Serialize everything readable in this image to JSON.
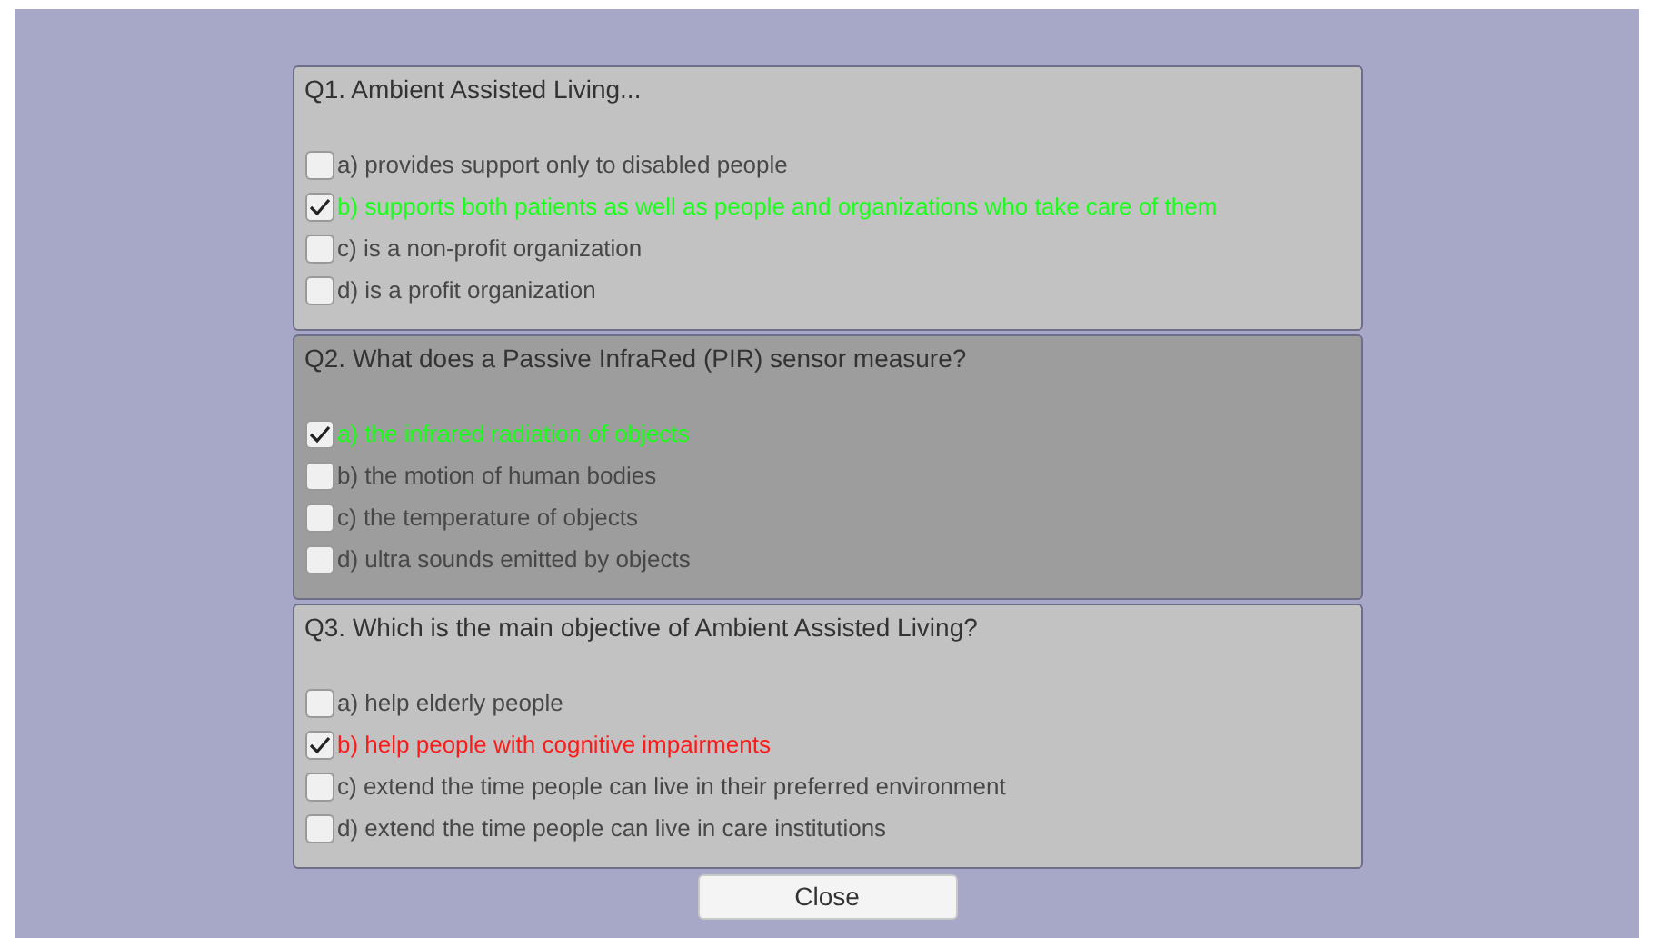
{
  "questions": [
    {
      "title": "Q1. Ambient Assisted Living...",
      "highlighted": false,
      "answers": [
        {
          "label": "a) provides support only to disabled people",
          "checked": false,
          "color": "#474747"
        },
        {
          "label": "b) supports both patients as well as people and organizations who take care of them",
          "checked": true,
          "color": "#1aff1a"
        },
        {
          "label": "c) is a non-profit organization",
          "checked": false,
          "color": "#474747"
        },
        {
          "label": "d) is a profit organization",
          "checked": false,
          "color": "#474747"
        }
      ]
    },
    {
      "title": "Q2. What does a Passive InfraRed (PIR) sensor measure?",
      "highlighted": true,
      "answers": [
        {
          "label": "a) the infrared radiation of objects",
          "checked": true,
          "color": "#1aff1a"
        },
        {
          "label": "b) the motion of human bodies",
          "checked": false,
          "color": "#474747"
        },
        {
          "label": "c) the temperature of objects",
          "checked": false,
          "color": "#474747"
        },
        {
          "label": "d) ultra sounds emitted by objects",
          "checked": false,
          "color": "#474747"
        }
      ]
    },
    {
      "title": "Q3. Which is the main objective of Ambient Assisted Living?",
      "highlighted": false,
      "answers": [
        {
          "label": "a) help elderly people",
          "checked": false,
          "color": "#474747"
        },
        {
          "label": "b) help people with cognitive impairments",
          "checked": true,
          "color": "#ff1a1a"
        },
        {
          "label": "c) extend the time people can live in their preferred environment",
          "checked": false,
          "color": "#474747"
        },
        {
          "label": "d) extend the time people can live in care institutions",
          "checked": false,
          "color": "#474747"
        }
      ]
    }
  ],
  "close_button": "Close"
}
